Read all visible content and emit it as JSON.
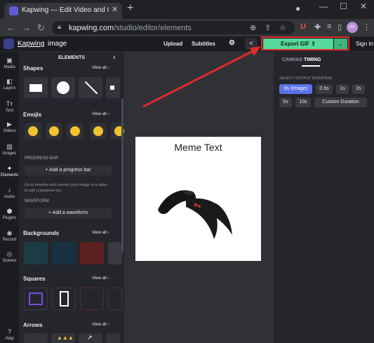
{
  "browser": {
    "tab_title": "Kapwing — Edit Video and Create...",
    "url_domain": "kapwing.com",
    "url_path": "/studio/editor/elements",
    "avatar_initials": "GK"
  },
  "app": {
    "brand": "Kapwing",
    "separator": "›",
    "project": "image",
    "upload_label": "Upload",
    "subtitles_label": "Subtitles",
    "export_label": "Export GIF",
    "signin_label": "Sign In"
  },
  "rail": [
    {
      "icon": "▣",
      "label": "Media"
    },
    {
      "icon": "◧",
      "label": "Layers"
    },
    {
      "icon": "Tт",
      "label": "Text"
    },
    {
      "icon": "▶",
      "label": "Videos"
    },
    {
      "icon": "▨",
      "label": "Images"
    },
    {
      "icon": "✦",
      "label": "Elements"
    },
    {
      "icon": "♪",
      "label": "Audio"
    },
    {
      "icon": "⬢",
      "label": "Plugins"
    },
    {
      "icon": "◉",
      "label": "Record"
    },
    {
      "icon": "◎",
      "label": "Scenes"
    },
    {
      "icon": "?",
      "label": "Help"
    }
  ],
  "panel": {
    "title": "ELEMENTS",
    "shapes": "Shapes",
    "emojis": "Emojis",
    "progress_bar": "PROGRESS BAR",
    "add_progress": "Add a progress bar",
    "progress_hint": "Go to timeline and convert your image to a video to add a progress bar.",
    "waveform": "WAVEFORM",
    "add_waveform": "Add a waveform",
    "backgrounds": "Backgrounds",
    "squares": "Squares",
    "arrows": "Arrows",
    "view_all": "View all ›"
  },
  "canvas": {
    "meme_text": "Meme Text"
  },
  "right": {
    "tab_canvas": "CANVAS",
    "tab_timing": "TIMING",
    "duration_label": "SELECT OUTPUT DURATION",
    "durations": [
      "0s (Image)",
      "0.5s",
      "1s",
      "2s",
      "5s",
      "10s",
      "Custom Duration"
    ]
  },
  "colors": {
    "accent": "#56d89a",
    "highlight": "#e02b2b",
    "selected": "#5b73e8"
  }
}
